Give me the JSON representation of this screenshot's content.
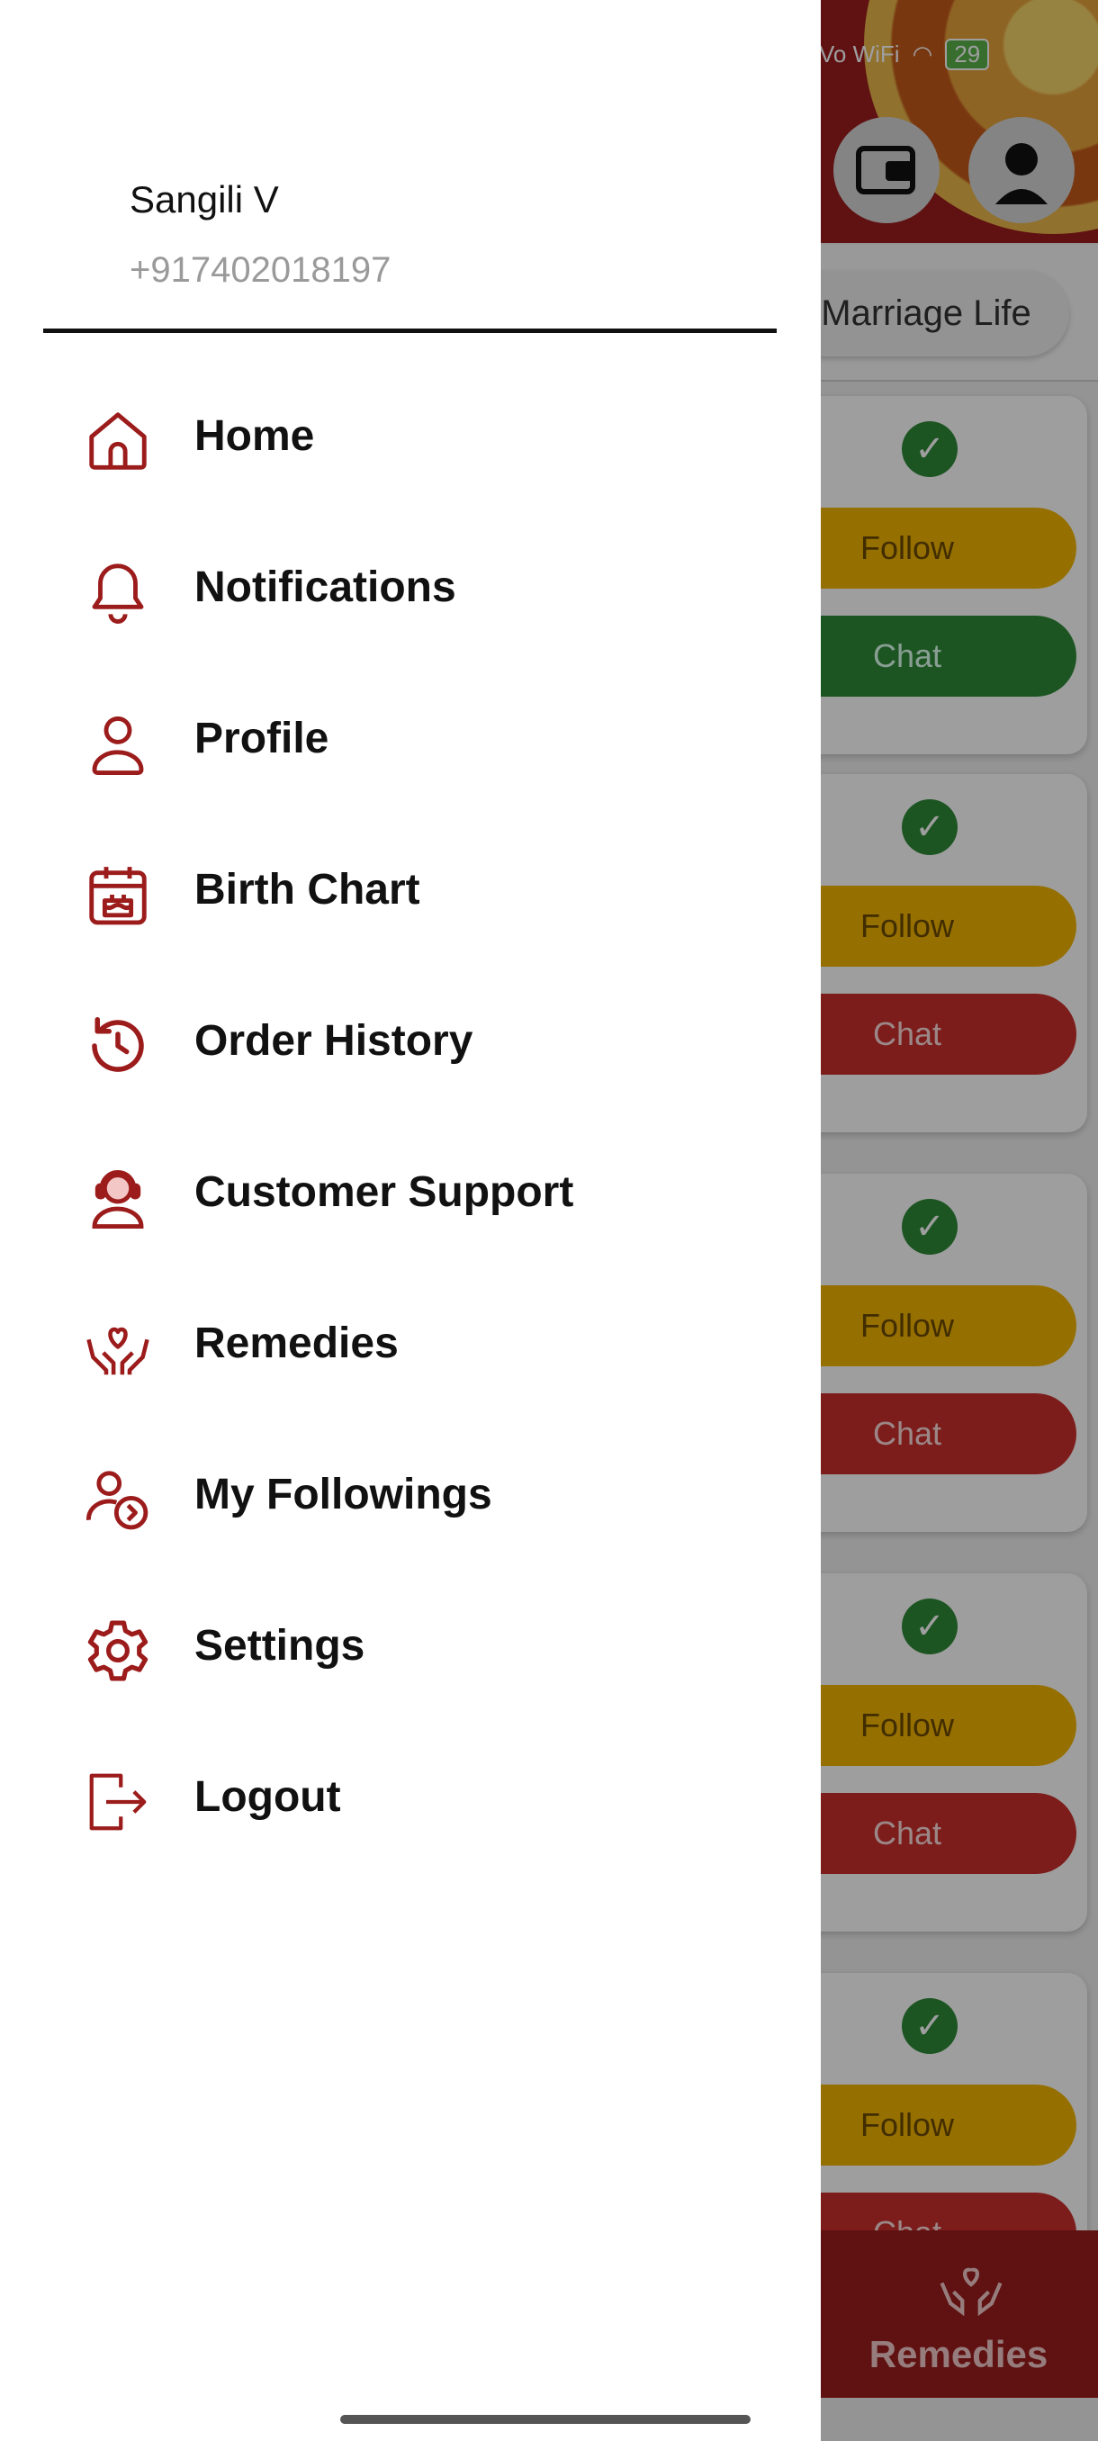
{
  "status_bar": {
    "vowifi": "Vo WiFi",
    "battery": "29"
  },
  "background": {
    "tab_chip": "Marriage Life",
    "cards": [
      {
        "follow": "Follow",
        "chat": "Chat",
        "chat_color": "#2e8a37"
      },
      {
        "follow": "Follow",
        "chat": "Chat",
        "chat_color": "#c9302c"
      },
      {
        "follow": "Follow",
        "chat": "Chat",
        "chat_color": "#c9302c"
      },
      {
        "follow": "Follow",
        "chat": "Chat",
        "chat_color": "#c9302c"
      },
      {
        "follow": "Follow",
        "chat": "Chat",
        "chat_color": "#c9302c"
      }
    ],
    "bottom_nav_label": "Remedies"
  },
  "drawer": {
    "user": {
      "name": "Sangili V",
      "phone": "+917402018197"
    },
    "accent_color": "#9c1c1c",
    "items": [
      {
        "label": "Home",
        "icon": "home-icon"
      },
      {
        "label": "Notifications",
        "icon": "bell-icon"
      },
      {
        "label": "Profile",
        "icon": "user-icon"
      },
      {
        "label": "Birth Chart",
        "icon": "calendar-cake-icon"
      },
      {
        "label": "Order History",
        "icon": "history-icon"
      },
      {
        "label": "Customer Support",
        "icon": "headset-agent-icon"
      },
      {
        "label": "Remedies",
        "icon": "hands-heart-icon"
      },
      {
        "label": "My Followings",
        "icon": "user-arrow-icon"
      },
      {
        "label": "Settings",
        "icon": "gear-icon"
      },
      {
        "label": "Logout",
        "icon": "logout-icon"
      }
    ]
  }
}
